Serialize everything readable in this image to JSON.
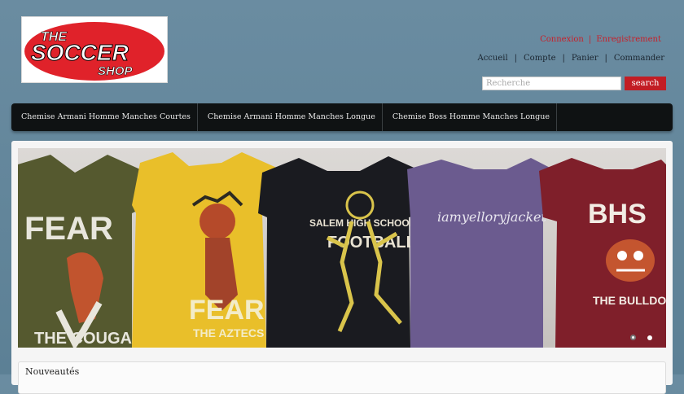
{
  "logo": {
    "line1": "THE",
    "line2": "SOCCER",
    "line3": "SHOP"
  },
  "top_links": {
    "login": "Connexion",
    "separator": "|",
    "register": "Enregistrement"
  },
  "nav_links": [
    {
      "label": "Accueil"
    },
    {
      "label": "Compte"
    },
    {
      "label": "Panier"
    },
    {
      "label": "Commander"
    }
  ],
  "search": {
    "placeholder": "Recherche",
    "button_label": "search"
  },
  "menu": [
    {
      "label": "Chemise Armani Homme Manches Courtes"
    },
    {
      "label": "Chemise Armani Homme Manches Longue"
    },
    {
      "label": "Chemise Boss Homme Manches Longue"
    }
  ],
  "slider": {
    "shirts": [
      {
        "text": "FEAR",
        "subtext": "THE COUGARS",
        "color": "#55592f"
      },
      {
        "text": "FEAR",
        "subtext": "THE AZTECS",
        "color": "#e9bf2a"
      },
      {
        "text": "SALEM HIGH SCHOOL",
        "subtext": "FOOTBALL",
        "color": "#1a1b20"
      },
      {
        "text": "iamyelloryjacket",
        "subtext": "",
        "color": "#6b5b8f"
      },
      {
        "text": "BHS",
        "subtext": "THE BULLDOGS",
        "color": "#7f1f2a"
      }
    ],
    "slides_count": 2,
    "active_slide": 1
  },
  "news": {
    "title": "Nouveautés"
  },
  "colors": {
    "accent": "#c21d24",
    "background": "#5f8399",
    "menu_bg": "#0f1213"
  }
}
